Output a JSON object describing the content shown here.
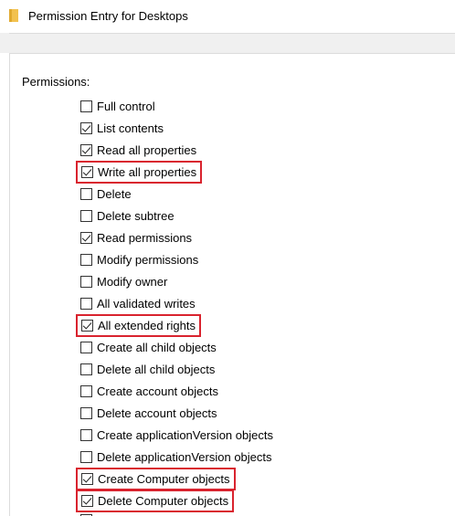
{
  "window": {
    "title": "Permission Entry for Desktops",
    "icon": "folder-icon"
  },
  "section": {
    "label": "Permissions:"
  },
  "accent": {
    "highlight_color": "#d9232e",
    "folder_color": "#f2c14e"
  },
  "permissions": [
    {
      "label": "Full control",
      "checked": false,
      "highlighted": false
    },
    {
      "label": "List contents",
      "checked": true,
      "highlighted": false
    },
    {
      "label": "Read all properties",
      "checked": true,
      "highlighted": false
    },
    {
      "label": "Write all properties",
      "checked": true,
      "highlighted": true
    },
    {
      "label": "Delete",
      "checked": false,
      "highlighted": false
    },
    {
      "label": "Delete subtree",
      "checked": false,
      "highlighted": false
    },
    {
      "label": "Read permissions",
      "checked": true,
      "highlighted": false
    },
    {
      "label": "Modify permissions",
      "checked": false,
      "highlighted": false
    },
    {
      "label": "Modify owner",
      "checked": false,
      "highlighted": false
    },
    {
      "label": "All validated writes",
      "checked": false,
      "highlighted": false
    },
    {
      "label": "All extended rights",
      "checked": true,
      "highlighted": true
    },
    {
      "label": "Create all child objects",
      "checked": false,
      "highlighted": false
    },
    {
      "label": "Delete all child objects",
      "checked": false,
      "highlighted": false
    },
    {
      "label": "Create account objects",
      "checked": false,
      "highlighted": false
    },
    {
      "label": "Delete account objects",
      "checked": false,
      "highlighted": false
    },
    {
      "label": "Create applicationVersion objects",
      "checked": false,
      "highlighted": false
    },
    {
      "label": "Delete applicationVersion objects",
      "checked": false,
      "highlighted": false
    },
    {
      "label": "Create Computer objects",
      "checked": true,
      "highlighted": true
    },
    {
      "label": "Delete Computer objects",
      "checked": true,
      "highlighted": true
    }
  ]
}
